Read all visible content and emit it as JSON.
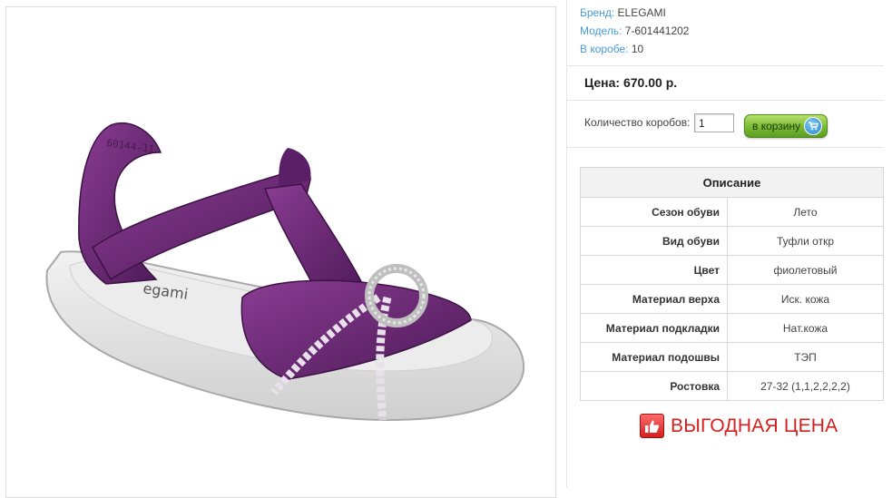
{
  "product": {
    "brand_label": "Бренд:",
    "brand_value": "ELEGAMI",
    "model_label": "Модель:",
    "model_value": "7-601441202",
    "box_label": "В коробе:",
    "box_value": "10",
    "image_sole_text": "60144-11",
    "image_insole_text": "egami"
  },
  "price": {
    "text": "Цена: 670.00 р."
  },
  "order": {
    "qty_label": "Количество коробов:",
    "qty_value": "1",
    "cart_button_label": "в корзину",
    "cart_icon": "cart-icon"
  },
  "description": {
    "title": "Описание",
    "rows": [
      {
        "key": "Сезон обуви",
        "value": "Лето"
      },
      {
        "key": "Вид обуви",
        "value": "Туфли откр"
      },
      {
        "key": "Цвет",
        "value": "фиолетовый"
      },
      {
        "key": "Материал верха",
        "value": "Иск. кожа"
      },
      {
        "key": "Материал подкладки",
        "value": "Нат.кожа"
      },
      {
        "key": "Материал подошвы",
        "value": "ТЭП"
      },
      {
        "key": "Ростовка",
        "value": "27-32 (1,1,2,2,2,2)"
      }
    ]
  },
  "promo": {
    "icon": "thumbs-up-icon",
    "text": "ВЫГОДНАЯ ЦЕНА"
  },
  "colors": {
    "link": "#4a9bd6",
    "promo": "#d81d1d",
    "button": "#79b934",
    "shoe": "#6e2a78"
  }
}
